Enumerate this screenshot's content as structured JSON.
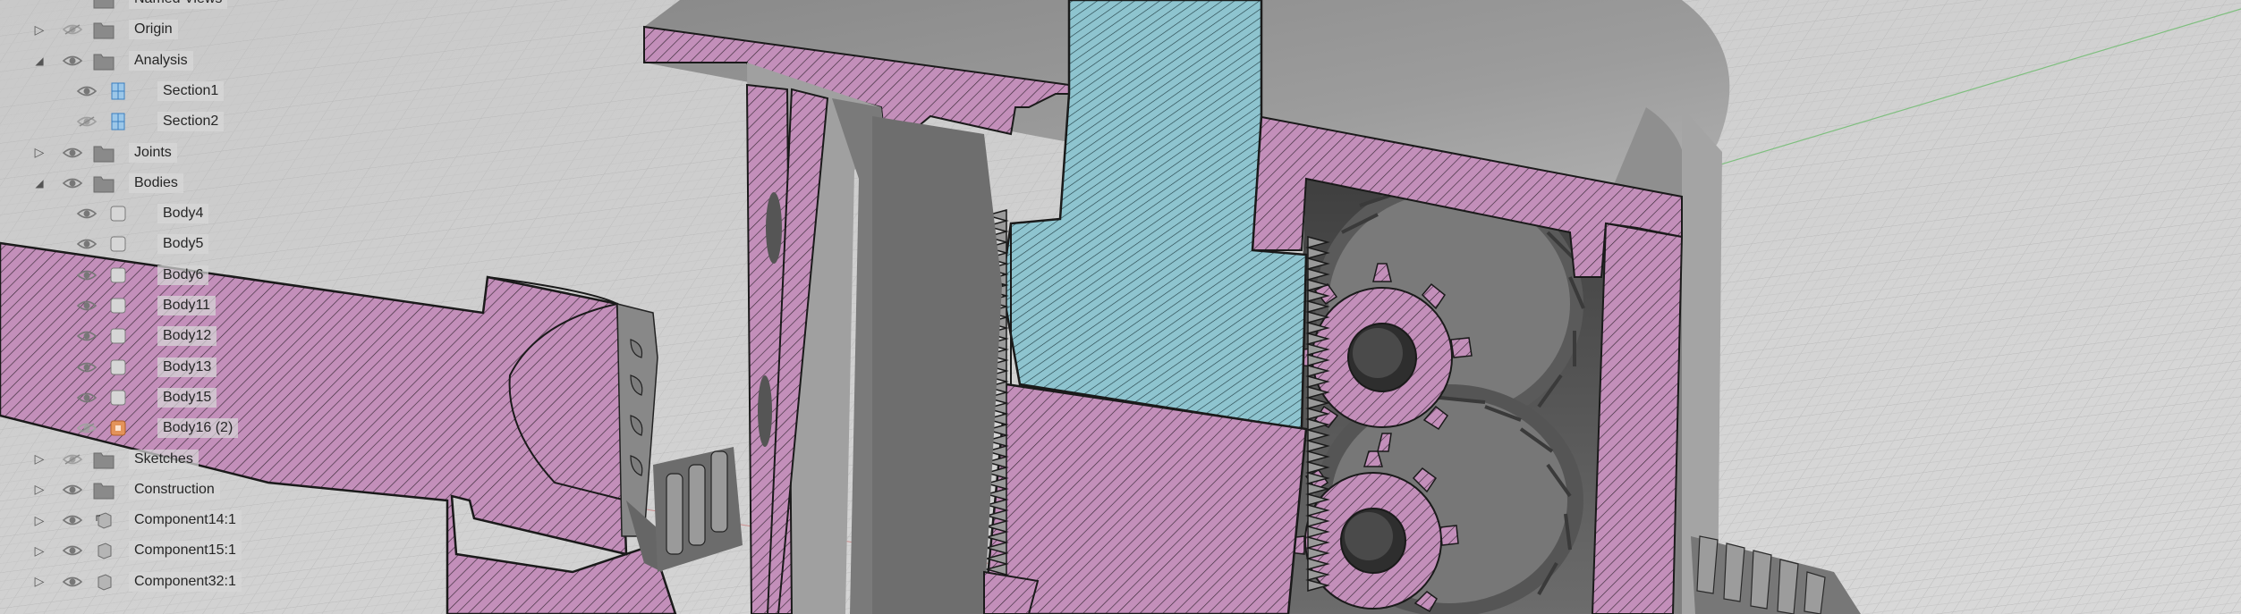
{
  "browser": {
    "items": [
      {
        "label": "Named Views",
        "depth": 0,
        "expander": "",
        "eye": "none",
        "icon": "folder-icon"
      },
      {
        "label": "Origin",
        "depth": 0,
        "expander": "collapsed",
        "eye": "hidden",
        "icon": "folder-icon"
      },
      {
        "label": "Analysis",
        "depth": 0,
        "expander": "expanded",
        "eye": "visible",
        "icon": "folder-icon"
      },
      {
        "label": "Section1",
        "depth": 1,
        "expander": "",
        "eye": "visible",
        "icon": "section-analysis-icon"
      },
      {
        "label": "Section2",
        "depth": 1,
        "expander": "",
        "eye": "hidden",
        "icon": "section-analysis-icon"
      },
      {
        "label": "Joints",
        "depth": 0,
        "expander": "collapsed",
        "eye": "visible",
        "icon": "folder-icon"
      },
      {
        "label": "Bodies",
        "depth": 0,
        "expander": "expanded",
        "eye": "visible",
        "icon": "folder-icon"
      },
      {
        "label": "Body4",
        "depth": 1,
        "expander": "",
        "eye": "visible",
        "icon": "body-icon"
      },
      {
        "label": "Body5",
        "depth": 1,
        "expander": "",
        "eye": "visible",
        "icon": "body-icon"
      },
      {
        "label": "Body6",
        "depth": 1,
        "expander": "",
        "eye": "visible",
        "icon": "body-icon"
      },
      {
        "label": "Body11",
        "depth": 1,
        "expander": "",
        "eye": "visible",
        "icon": "body-icon"
      },
      {
        "label": "Body12",
        "depth": 1,
        "expander": "",
        "eye": "visible",
        "icon": "body-icon"
      },
      {
        "label": "Body13",
        "depth": 1,
        "expander": "",
        "eye": "visible",
        "icon": "body-icon"
      },
      {
        "label": "Body15",
        "depth": 1,
        "expander": "",
        "eye": "visible",
        "icon": "body-icon"
      },
      {
        "label": "Body16 (2)",
        "depth": 1,
        "expander": "",
        "eye": "hidden",
        "icon": "body-orange-icon"
      },
      {
        "label": "Sketches",
        "depth": 0,
        "expander": "collapsed",
        "eye": "hidden",
        "icon": "folder-icon"
      },
      {
        "label": "Construction",
        "depth": 0,
        "expander": "collapsed",
        "eye": "visible",
        "icon": "folder-icon"
      },
      {
        "label": "Component14:1",
        "depth": 0,
        "expander": "collapsed",
        "eye": "visible",
        "icon": "component-linked-icon"
      },
      {
        "label": "Component15:1",
        "depth": 0,
        "expander": "collapsed",
        "eye": "visible",
        "icon": "component-icon"
      },
      {
        "label": "Component32:1",
        "depth": 0,
        "expander": "collapsed",
        "eye": "visible",
        "icon": "component-icon"
      }
    ]
  },
  "colors": {
    "section_pink": "#c38fba",
    "section_cyan": "#8ec4cf",
    "part_gray": "#8d8d8d",
    "part_dark": "#5b5b5b",
    "ground": "#d2d2d2",
    "outline": "#1a1a1a"
  }
}
